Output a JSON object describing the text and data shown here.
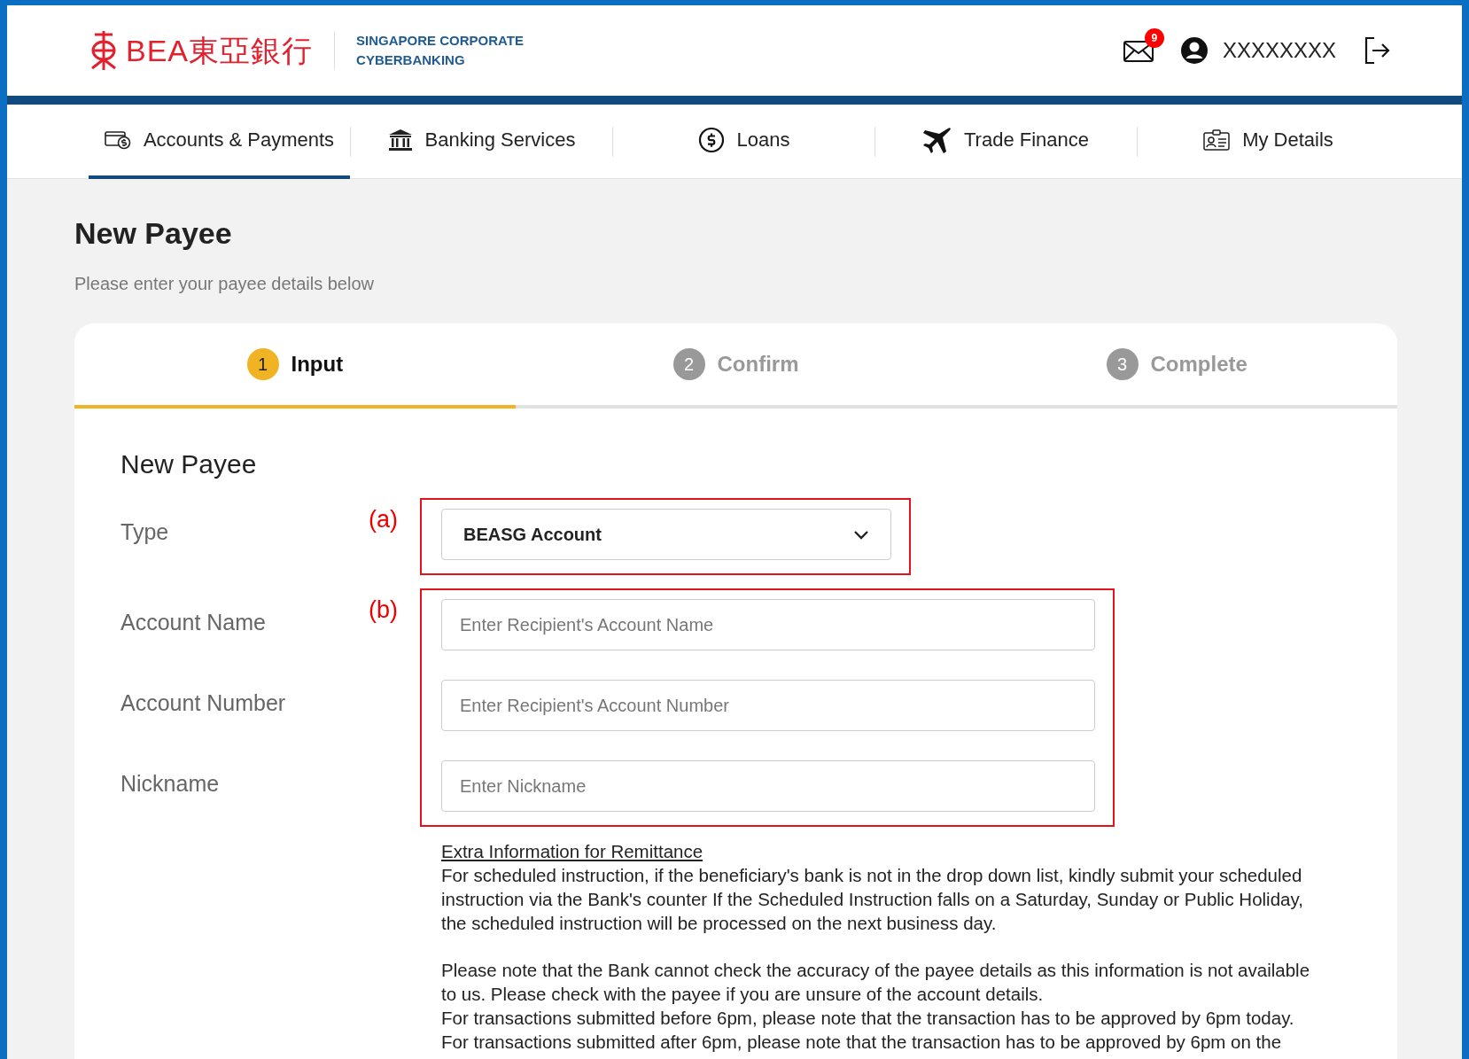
{
  "header": {
    "logo_text": "BEA東亞銀行",
    "tagline_lines": [
      "SINGAPORE CORPORATE",
      "CYBERBANKING"
    ],
    "mail_badge": "9",
    "username": "XXXXXXXX"
  },
  "nav": [
    {
      "label": "Accounts & Payments",
      "selected": true
    },
    {
      "label": "Banking Services",
      "selected": false
    },
    {
      "label": "Loans",
      "selected": false
    },
    {
      "label": "Trade Finance",
      "selected": false
    },
    {
      "label": "My Details",
      "selected": false
    }
  ],
  "page": {
    "title": "New Payee",
    "subtitle": "Please enter your payee details below"
  },
  "steps": [
    {
      "number": "1",
      "label": "Input",
      "selected": true
    },
    {
      "number": "2",
      "label": "Confirm",
      "selected": false
    },
    {
      "number": "3",
      "label": "Complete",
      "selected": false
    }
  ],
  "form": {
    "title": "New Payee",
    "groups": [
      {
        "annotation": "(a)",
        "fields": [
          {
            "kind": "select",
            "label": "Type",
            "value": "BEASG Account"
          }
        ]
      },
      {
        "annotation": "(b)",
        "fields": [
          {
            "kind": "text",
            "label": "Account Name",
            "placeholder": "Enter Recipient's Account Name"
          },
          {
            "kind": "text",
            "label": "Account Number",
            "placeholder": "Enter Recipient's Account Number"
          },
          {
            "kind": "text",
            "label": "Nickname",
            "placeholder": "Enter Nickname"
          }
        ]
      }
    ]
  },
  "info": {
    "link": "Extra Information for Remittance",
    "paragraphs": [
      [
        "For scheduled instruction, if the beneficiary's bank is not in the drop down list, kindly submit your scheduled instruction via the Bank's counter If the Scheduled Instruction falls on a Saturday, Sunday or Public Holiday, the scheduled instruction will be processed on the next business day."
      ],
      [
        "Please note that the Bank cannot check the accuracy of the payee details as this information is not available to us. Please check with the payee if you are unsure of the account details.",
        "For transactions submitted before 6pm, please note that the transaction has to be approved by 6pm today.",
        "For transactions submitted after 6pm, please note that the transaction has to be approved by 6pm on the"
      ]
    ]
  }
}
